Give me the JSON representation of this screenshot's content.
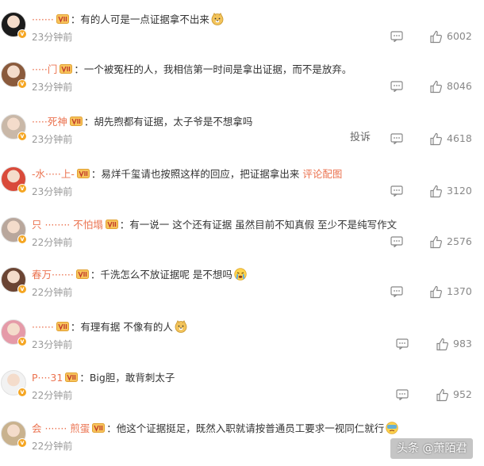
{
  "comments": [
    {
      "user": "·······",
      "content": "有的人可是一点证据拿不出来",
      "time": "23分钟前",
      "likes": "6002",
      "emoji": "doge",
      "avatar_color": "#1b1b1b"
    },
    {
      "user": "·····门",
      "content": "一个被冤枉的人，我相信第一时间是拿出证据，而不是放弃。",
      "time": "23分钟前",
      "likes": "8046",
      "avatar_color": "#8a5a3c"
    },
    {
      "user": "·····死神",
      "content": "胡先煦都有证据，太子爷是不想拿吗",
      "time": "23分钟前",
      "likes": "4618",
      "report": "投诉",
      "avatar_color": "#c9b8a8"
    },
    {
      "user": "-水·····上-",
      "content": "易烊千玺请也按照这样的回应，把证据拿出来 ",
      "link": "评论配图",
      "time": "23分钟前",
      "likes": "3120",
      "avatar_color": "#d94a3a"
    },
    {
      "user": "只 ········ 不怕塌",
      "content": "有一说一 这个还有证据 虽然目前不知真假 至少不是纯写作文",
      "time": "22分钟前",
      "likes": "2576",
      "avatar_color": "#b9a79c"
    },
    {
      "user": "春万·······",
      "content": "千洗怎么不放证据呢 是不想吗",
      "time": "22分钟前",
      "likes": "1370",
      "emoji": "cry",
      "avatar_color": "#6b4433"
    },
    {
      "user": "·······",
      "content": "有理有据 不像有的人",
      "time": "23分钟前",
      "likes": "983",
      "emoji": "doge",
      "avatar_color": "#e59aa8"
    },
    {
      "user": "P····31",
      "content": "Big胆，敢背刺太子",
      "time": "22分钟前",
      "likes": "952",
      "avatar_color": "#f2f2f2"
    },
    {
      "user": "会 ······· 煎蛋",
      "content": "他这个证据挺足，既然入职就请按普通员工要求一视同仁就行",
      "time": "22分钟前",
      "likes": "",
      "emoji": "facepalm",
      "avatar_color": "#c9b28e"
    }
  ],
  "watermark": "头条 @萧陌君",
  "colors": {
    "username": "#eb7350",
    "time": "#999999",
    "link": "#eb7350"
  }
}
